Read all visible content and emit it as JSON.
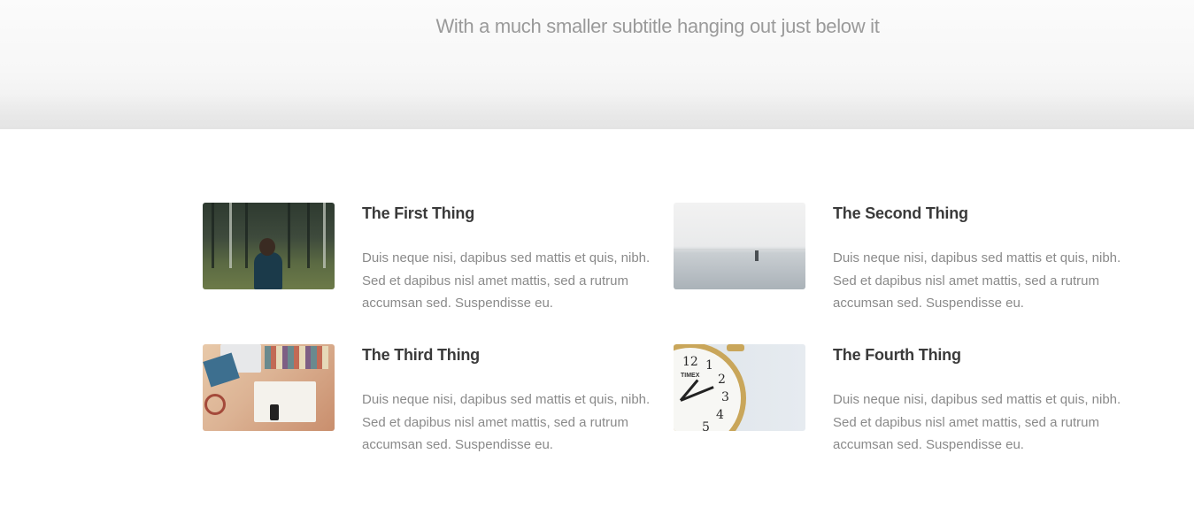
{
  "hero": {
    "subtitle": "With a much smaller subtitle hanging out just below it"
  },
  "features": [
    {
      "title": "The First Thing",
      "text": "Duis neque nisi, dapibus sed mattis et quis, nibh. Sed et dapibus nisl amet mattis, sed a rutrum accumsan sed. Suspendisse eu.",
      "image": "forest-photo"
    },
    {
      "title": "The Second Thing",
      "text": "Duis neque nisi, dapibus sed mattis et quis, nibh. Sed et dapibus nisl amet mattis, sed a rutrum accumsan sed. Suspendisse eu.",
      "image": "lake-photo"
    },
    {
      "title": "The Third Thing",
      "text": "Duis neque nisi, dapibus sed mattis et quis, nibh. Sed et dapibus nisl amet mattis, sed a rutrum accumsan sed. Suspendisse eu.",
      "image": "desk-photo"
    },
    {
      "title": "The Fourth Thing",
      "text": "Duis neque nisi, dapibus sed mattis et quis, nibh. Sed et dapibus nisl amet mattis, sed a rutrum accumsan sed. Suspendisse eu.",
      "image": "clock-photo",
      "clock": {
        "brand": "TIMEX",
        "numerals": [
          "12",
          "1",
          "2",
          "3",
          "4",
          "5"
        ]
      }
    }
  ],
  "colors": {
    "title": "#3a3a3a",
    "text": "#8a8a8a",
    "subtitle": "#9a9a9a",
    "background": "#ffffff"
  }
}
